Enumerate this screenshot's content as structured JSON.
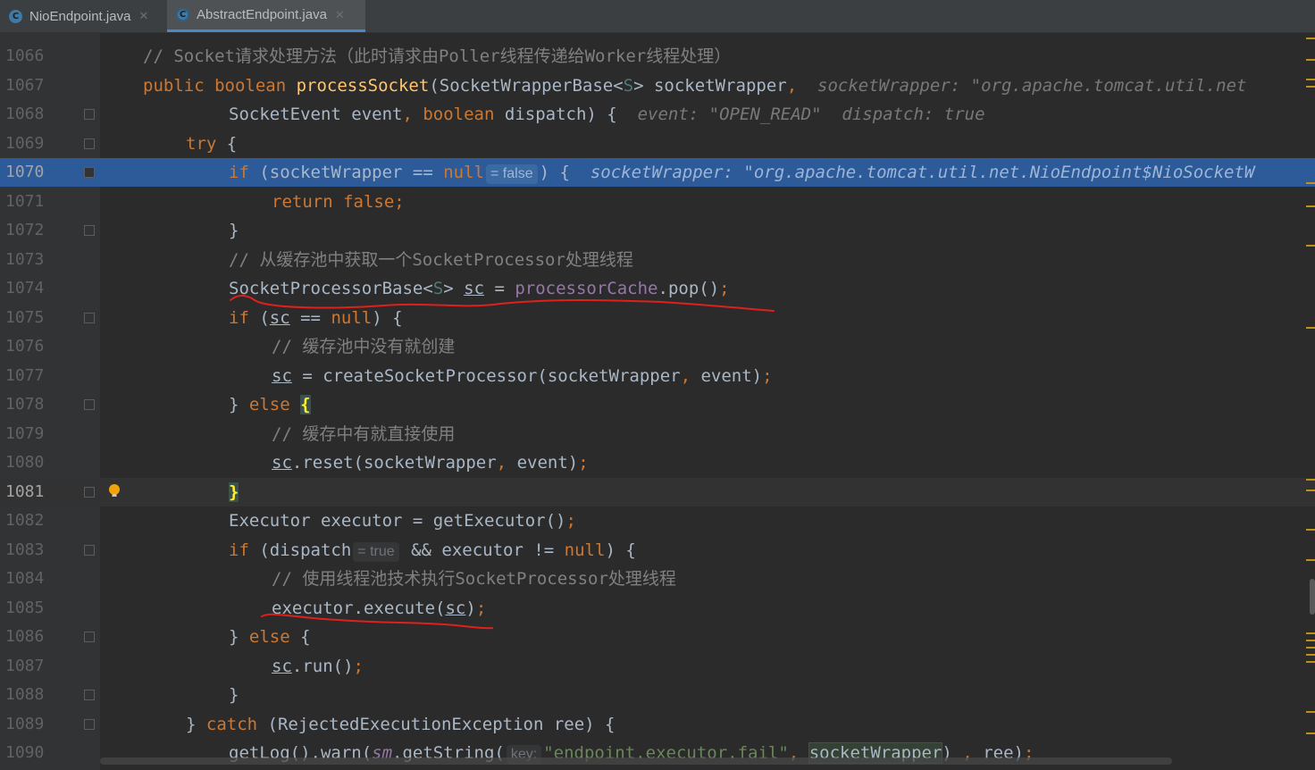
{
  "tabs": [
    {
      "label": "NioEndpoint.java",
      "icon": "class-icon",
      "active": false
    },
    {
      "label": "AbstractEndpoint.java",
      "icon": "abstract-class-icon",
      "active": true
    }
  ],
  "lines": {
    "n1066": "1066",
    "n1067": "1067",
    "n1068": "1068",
    "n1069": "1069",
    "n1070": "1070",
    "n1071": "1071",
    "n1072": "1072",
    "n1073": "1073",
    "n1074": "1074",
    "n1075": "1075",
    "n1076": "1076",
    "n1077": "1077",
    "n1078": "1078",
    "n1079": "1079",
    "n1080": "1080",
    "n1081": "1081",
    "n1082": "1082",
    "n1083": "1083",
    "n1084": "1084",
    "n1085": "1085",
    "n1086": "1086",
    "n1087": "1087",
    "n1088": "1088",
    "n1089": "1089",
    "n1090": "1090"
  },
  "code": {
    "c1066": "// Socket请求处理方法（此时请求由Poller线程传递给Worker线程处理）",
    "c1067_kw": "public boolean ",
    "c1067_fn": "processSocket",
    "c1067_a": "(SocketWrapperBase<",
    "c1067_gen": "S",
    "c1067_b": "> socketWrapper",
    "c1067_comma": ",",
    "c1067_hint": "socketWrapper: \"org.apache.tomcat.util.net",
    "c1068_a": "SocketEvent event",
    "c1068_comma": ",",
    "c1068_kw": " boolean ",
    "c1068_b": "dispatch) {",
    "c1068_hint": "event: \"OPEN_READ\"  dispatch: true",
    "c1069_kw": "try",
    "c1069_b": " {",
    "c1070_kw": "if",
    "c1070_a": " (socketWrapper == ",
    "c1070_null": "null",
    "c1070_inlay": "= false",
    "c1070_b": ") {",
    "c1070_hint": "socketWrapper: \"org.apache.tomcat.util.net.NioEndpoint$NioSocketW",
    "c1071": "return false;",
    "c1072": "}",
    "c1073": "// 从缓存池中获取一个SocketProcessor处理线程",
    "c1074_a": "SocketProcessorBase<",
    "c1074_gen": "S",
    "c1074_b": "> ",
    "c1074_sc": "sc",
    "c1074_c": " = ",
    "c1074_fld": "processorCache",
    "c1074_d": ".pop()",
    "c1074_semi": ";",
    "c1075_kw": "if",
    "c1075_a": " (",
    "c1075_sc": "sc",
    "c1075_b": " == ",
    "c1075_null": "null",
    "c1075_c": ") {",
    "c1076": "// 缓存池中没有就创建",
    "c1077_sc": "sc",
    "c1077_a": " = createSocketProcessor(socketWrapper",
    "c1077_comma": ",",
    "c1077_b": " event)",
    "c1077_semi": ";",
    "c1078_a": "} ",
    "c1078_kw": "else",
    "c1078_b": " ",
    "c1078_brace": "{",
    "c1079": "// 缓存中有就直接使用",
    "c1080_sc": "sc",
    "c1080_a": ".reset(socketWrapper",
    "c1080_comma": ",",
    "c1080_b": " event)",
    "c1080_semi": ";",
    "c1081": "}",
    "c1082_a": "Executor executor = getExecutor()",
    "c1082_semi": ";",
    "c1083_kw": "if",
    "c1083_a": " (dispatch",
    "c1083_inlay": "= true",
    "c1083_b": " && executor != ",
    "c1083_null": "null",
    "c1083_c": ") {",
    "c1084": "// 使用线程池技术执行SocketProcessor处理线程",
    "c1085_a": "executor.execute(",
    "c1085_sc": "sc",
    "c1085_b": ")",
    "c1085_semi": ";",
    "c1086_a": "} ",
    "c1086_kw": "else",
    "c1086_b": " {",
    "c1087_sc": "sc",
    "c1087_a": ".run()",
    "c1087_semi": ";",
    "c1088": "}",
    "c1089_a": "} ",
    "c1089_kw": "catch",
    "c1089_b": " (RejectedExecutionException ree) {",
    "c1090_a": "getLog().warn(",
    "c1090_fld": "sm",
    "c1090_b": ".getString(",
    "c1090_inlay": "key:",
    "c1090_str": "\"endpoint.executor.fail\"",
    "c1090_comma": ",",
    "c1090_box": "socketWrapper",
    "c1090_c": ") ",
    "c1090_comma2": ",",
    "c1090_d": " ree)",
    "c1090_semi": ";"
  },
  "colors": {
    "background": "#2b2b2b",
    "keyword": "#cc7832",
    "method": "#ffc66d",
    "comment": "#808080",
    "field": "#9876aa",
    "string": "#6a8759",
    "execution_line": "#2d5b9a",
    "annotation_pen": "#e0201c"
  }
}
